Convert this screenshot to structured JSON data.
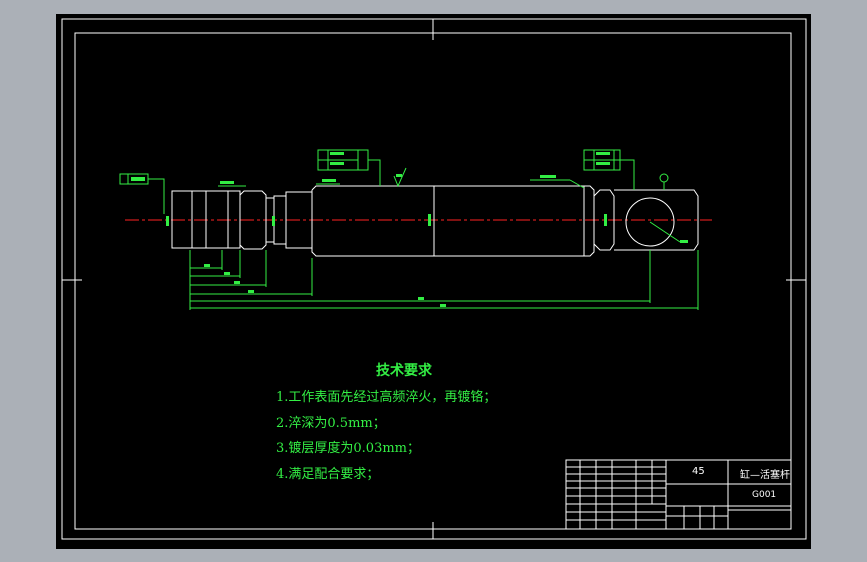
{
  "technical_requirements": {
    "title": "技术要求",
    "items": [
      "1.工作表面先经过高频淬火，再镀铬；",
      "2.淬深为0.5mm；",
      "3.镀层厚度为0.03mm；",
      "4.满足配合要求；"
    ]
  },
  "title_block": {
    "material": "45",
    "part_name": "缸—活塞杆",
    "drawing_no": "G001"
  },
  "colors": {
    "background": "#000000",
    "outline": "#ffffff",
    "dimension": "#33ee44",
    "centerline": "#ff2222",
    "note_text": "#33ee44",
    "viewport_frame": "#abb0b7"
  }
}
